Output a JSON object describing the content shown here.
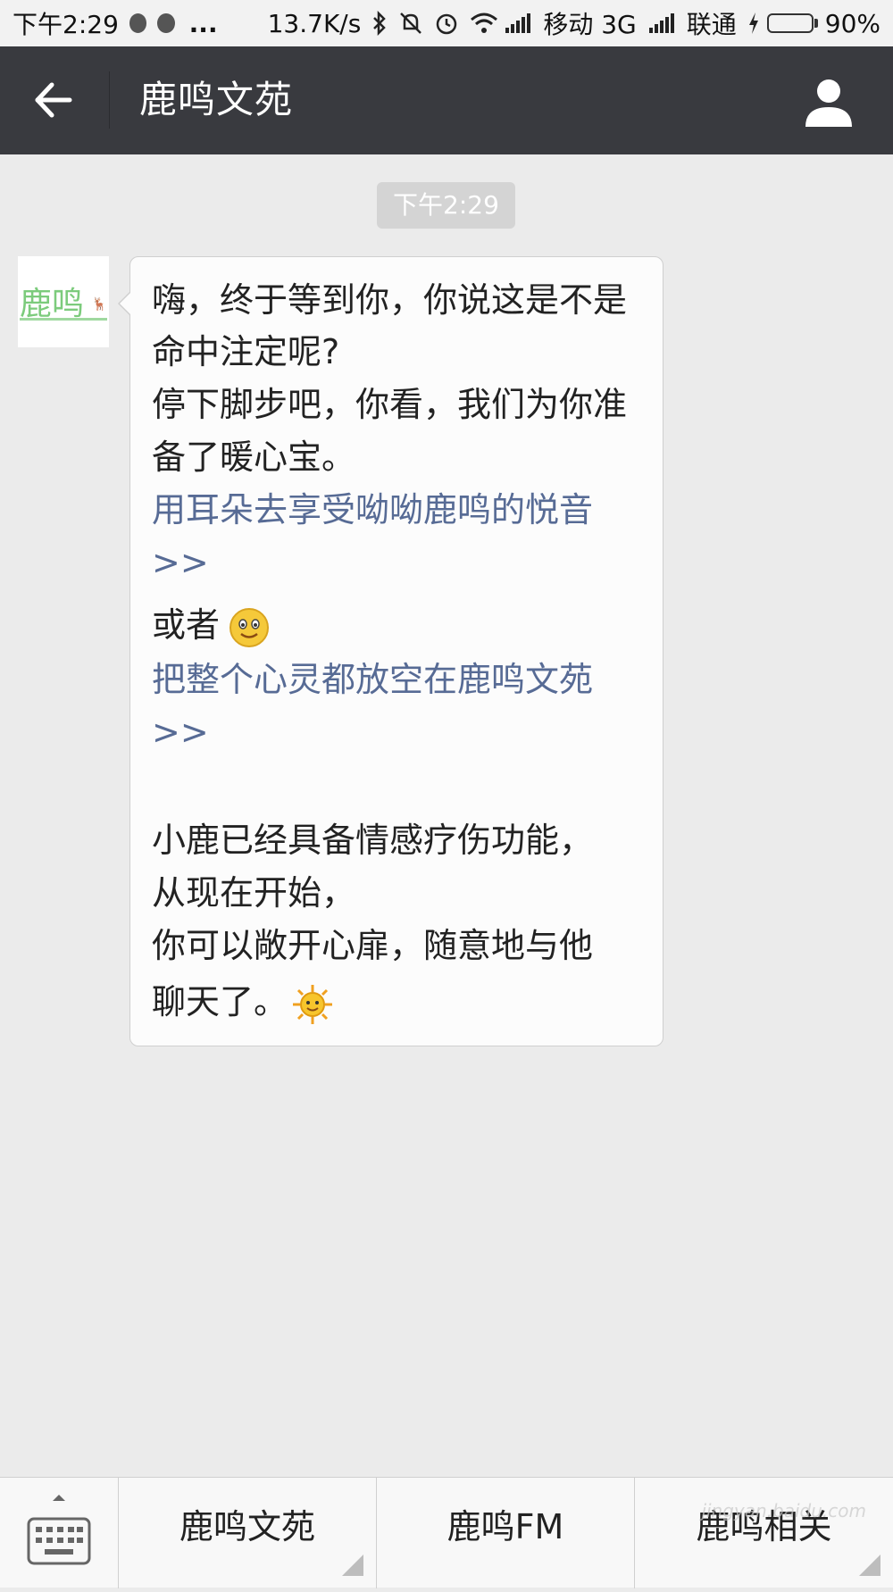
{
  "status_bar": {
    "time": "下午2:29",
    "dots": "...",
    "speed": "13.7K/s",
    "carrier1": "移动 3G",
    "carrier2": "联通",
    "battery": "90%",
    "battery_level": 0.9
  },
  "header": {
    "title": "鹿鸣文苑",
    "back_icon": "back-arrow-icon",
    "user_icon": "user-profile-icon"
  },
  "chat": {
    "timestamp": "下午2:29",
    "avatar_text": "鹿鸣",
    "message": {
      "line1": "嗨，终于等到你，你说这是不是",
      "line2": "命中注定呢?",
      "line3": "停下脚步吧，你看，我们为你准",
      "line4": "备了暖心宝。",
      "link1_line1": "用耳朵去享受呦呦鹿鸣的悦音",
      "link1_line2": ">>",
      "line5": "或者",
      "link2_line1": "把整个心灵都放空在鹿鸣文苑",
      "link2_line2": ">>",
      "line6": "小鹿已经具备情感疗伤功能，",
      "line7": "从现在开始，",
      "line8": "你可以敞开心扉，随意地与他",
      "line9": "聊天了。"
    },
    "link_color": "#576b95"
  },
  "bottom_menu": {
    "keyboard_icon": "keyboard-icon",
    "items": [
      {
        "label": "鹿鸣文苑"
      },
      {
        "label": "鹿鸣FM"
      },
      {
        "label": "鹿鸣相关"
      }
    ]
  },
  "watermark": "jingyan.baidu.com"
}
